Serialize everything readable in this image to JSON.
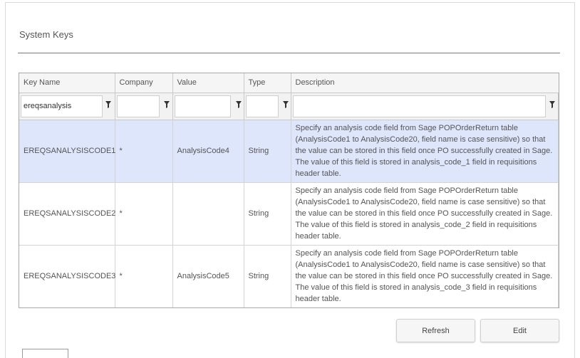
{
  "page": {
    "title": "System Keys"
  },
  "grid": {
    "columns": [
      "Key Name",
      "Company",
      "Value",
      "Type",
      "Description"
    ],
    "filters": {
      "key_name": "ereqsanalysis",
      "company": "",
      "value": "",
      "type": "",
      "description": ""
    },
    "rows": [
      {
        "key": "EREQSANALYSISCODE1",
        "company": "*",
        "value": "AnalysisCode4",
        "type": "String",
        "description": "Specify an analysis code field from Sage POPOrderReturn table (AnalysisCode1 to AnalysisCode20, field name is case sensitive) so that the value can be stored in this field once PO successfully created in Sage. The value of this field is stored in analysis_code_1 field in requisitions header table.",
        "selected": true
      },
      {
        "key": "EREQSANALYSISCODE2",
        "company": "*",
        "value": "",
        "type": "String",
        "description": "Specify an analysis code field from Sage POPOrderReturn table (AnalysisCode1 to AnalysisCode20, field name is case sensitive) so that the value can be stored in this field once PO successfully created in Sage. The value of this field is stored in analysis_code_2 field in requisitions header table.",
        "selected": false
      },
      {
        "key": "EREQSANALYSISCODE3",
        "company": "*",
        "value": "AnalysisCode5",
        "type": "String",
        "description": "Specify an analysis code field from Sage POPOrderReturn table (AnalysisCode1 to AnalysisCode20, field name is case sensitive) so that the value can be stored in this field once PO successfully created in Sage. The value of this field is stored in analysis_code_3 field in requisitions header table.",
        "selected": false
      }
    ]
  },
  "buttons": {
    "refresh": "Refresh",
    "edit": "Edit"
  },
  "icons": {
    "filter": "filter-icon"
  },
  "colors": {
    "selected_row": "#dde6fb",
    "header_bg": "#f5f5f5"
  }
}
